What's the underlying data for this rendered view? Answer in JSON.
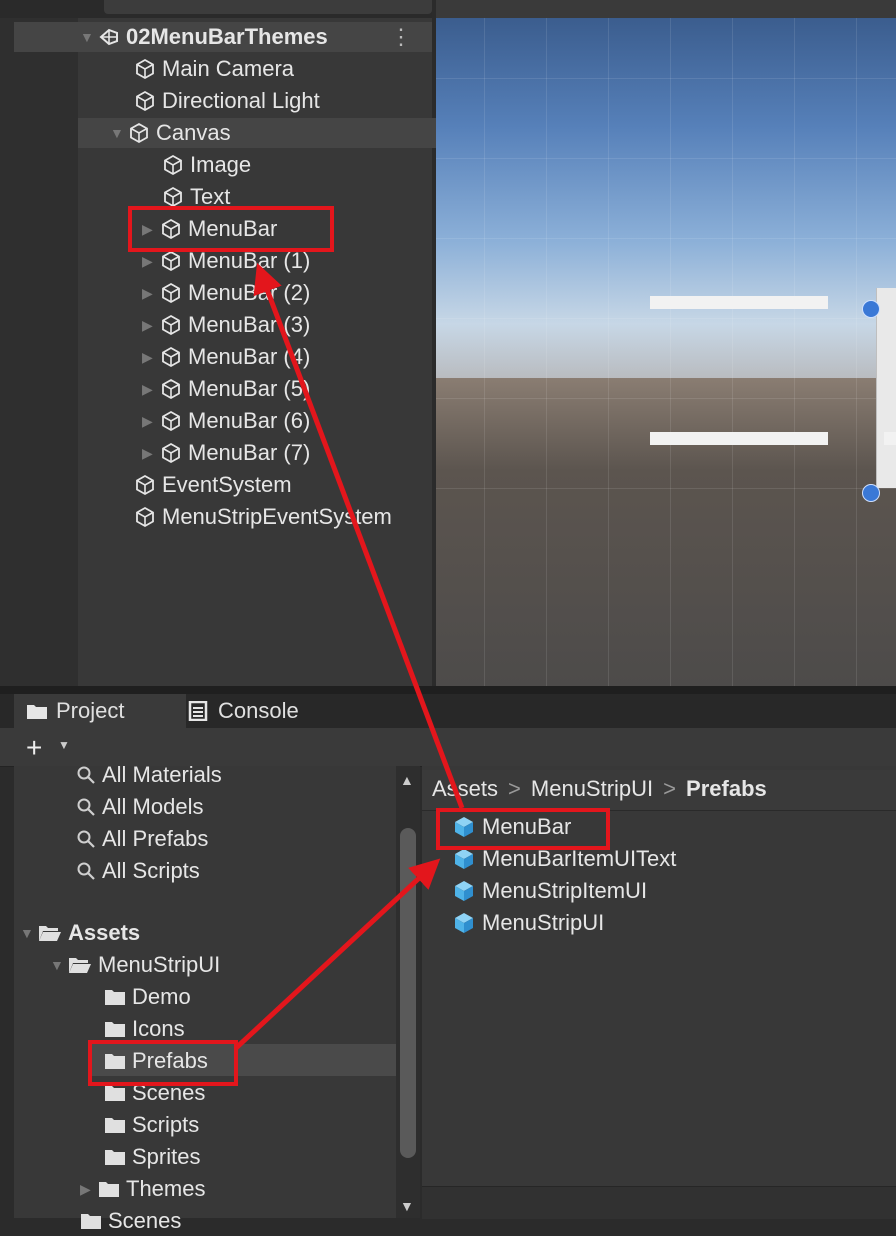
{
  "hierarchy": {
    "scene_name": "02MenuBarThemes",
    "kebab": "⋮",
    "items": [
      {
        "label": "Main Camera"
      },
      {
        "label": "Directional Light"
      },
      {
        "label": "Canvas"
      },
      {
        "label": "Image"
      },
      {
        "label": "Text"
      },
      {
        "label": "MenuBar"
      },
      {
        "label": "MenuBar (1)"
      },
      {
        "label": "MenuBar (2)"
      },
      {
        "label": "MenuBar (3)"
      },
      {
        "label": "MenuBar (4)"
      },
      {
        "label": "MenuBar (5)"
      },
      {
        "label": "MenuBar (6)"
      },
      {
        "label": "MenuBar (7)"
      },
      {
        "label": "EventSystem"
      },
      {
        "label": "MenuStripEventSystem"
      }
    ]
  },
  "project": {
    "tabs": [
      {
        "label": "Project",
        "icon": "folder-icon"
      },
      {
        "label": "Console",
        "icon": "console-icon"
      }
    ],
    "add_button": "+",
    "favorites": [
      {
        "label": "All Materials"
      },
      {
        "label": "All Models"
      },
      {
        "label": "All Prefabs"
      },
      {
        "label": "All Scripts"
      }
    ],
    "tree": {
      "root": "Assets",
      "menustrip": "MenuStripUI",
      "folders": [
        {
          "label": "Demo"
        },
        {
          "label": "Icons"
        },
        {
          "label": "Prefabs"
        },
        {
          "label": "Scenes"
        },
        {
          "label": "Scripts"
        },
        {
          "label": "Sprites"
        },
        {
          "label": "Themes"
        }
      ],
      "next_root": "Scenes"
    },
    "breadcrumb": {
      "part1": "Assets",
      "part2": "MenuStripUI",
      "part3": "Prefabs",
      "sep": ">"
    },
    "files": [
      {
        "label": "MenuBar"
      },
      {
        "label": "MenuBarItemUIText"
      },
      {
        "label": "MenuStripItemUI"
      },
      {
        "label": "MenuStripUI"
      }
    ]
  },
  "colors": {
    "highlight_red": "#e3161c",
    "prefab_blue": "#4fb3e8",
    "panel_bg": "#383838"
  }
}
